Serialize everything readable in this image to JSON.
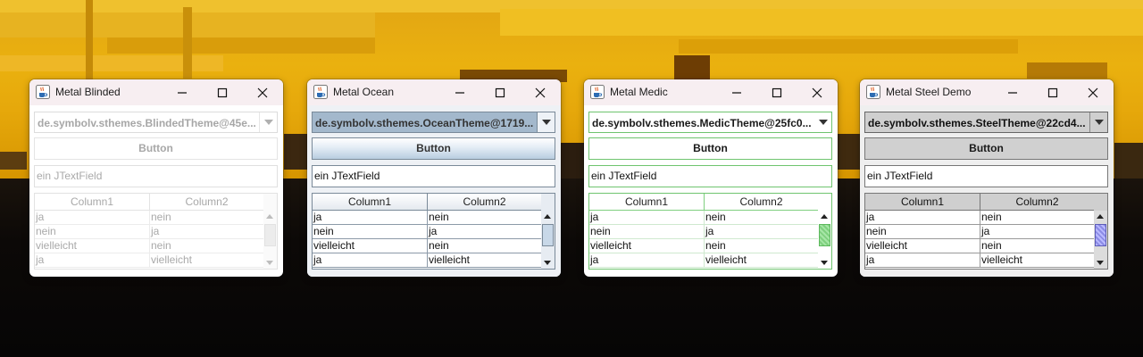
{
  "windows": [
    {
      "title": "Metal Blinded",
      "combo_value": "de.symbolv.sthemes.BlindedTheme@45e...",
      "button_label": "Button",
      "textfield_value": "ein JTextField",
      "table": {
        "columns": [
          "Column1",
          "Column2"
        ],
        "rows": [
          [
            "ja",
            "nein"
          ],
          [
            "nein",
            "ja"
          ],
          [
            "vielleicht",
            "nein"
          ],
          [
            "ja",
            "vielleicht"
          ]
        ]
      }
    },
    {
      "title": "Metal Ocean",
      "combo_value": "de.symbolv.sthemes.OceanTheme@1719...",
      "button_label": "Button",
      "textfield_value": "ein JTextField",
      "table": {
        "columns": [
          "Column1",
          "Column2"
        ],
        "rows": [
          [
            "ja",
            "nein"
          ],
          [
            "nein",
            "ja"
          ],
          [
            "vielleicht",
            "nein"
          ],
          [
            "ja",
            "vielleicht"
          ]
        ]
      }
    },
    {
      "title": "Metal Medic",
      "combo_value": "de.symbolv.sthemes.MedicTheme@25fc0...",
      "button_label": "Button",
      "textfield_value": "ein JTextField",
      "table": {
        "columns": [
          "Column1",
          "Column2"
        ],
        "rows": [
          [
            "ja",
            "nein"
          ],
          [
            "nein",
            "ja"
          ],
          [
            "vielleicht",
            "nein"
          ],
          [
            "ja",
            "vielleicht"
          ]
        ]
      }
    },
    {
      "title": "Metal Steel Demo",
      "combo_value": "de.symbolv.sthemes.SteelTheme@22cd4...",
      "button_label": "Button",
      "textfield_value": "ein JTextField",
      "table": {
        "columns": [
          "Column1",
          "Column2"
        ],
        "rows": [
          [
            "ja",
            "nein"
          ],
          [
            "nein",
            "ja"
          ],
          [
            "vielleicht",
            "nein"
          ],
          [
            "ja",
            "vielleicht"
          ]
        ]
      }
    }
  ],
  "icons": {
    "app": "java-coffee-cup-icon",
    "minimize": "minimize-icon",
    "maximize": "maximize-icon",
    "close": "close-icon",
    "dropdown": "chevron-down-icon",
    "scroll_up": "scroll-up-arrow-icon",
    "scroll_down": "scroll-down-arrow-icon"
  },
  "colors": {
    "titlebar_bg": "#f7eef1",
    "ocean_accent": "#a3b8cc",
    "medic_accent": "#6fc46f",
    "steel_accent": "#cfcfcf",
    "steel_thumb": "#8c8ce6",
    "desktop_sky": "#e6a80b",
    "desktop_ground": "#0b0806"
  }
}
